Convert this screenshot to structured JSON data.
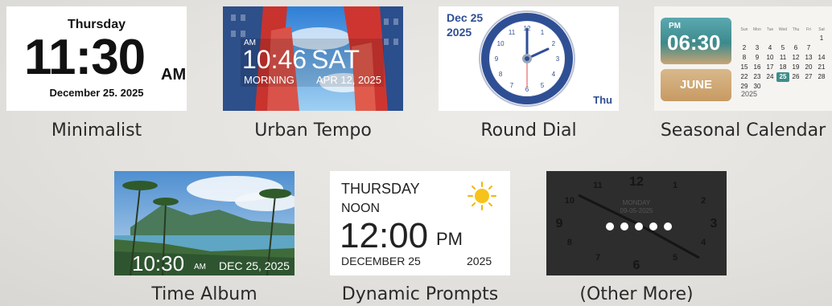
{
  "themes": [
    {
      "label": "Minimalist",
      "day": "Thursday",
      "time": "11:30",
      "ampm": "AM",
      "date": "December 25. 2025"
    },
    {
      "label": "Urban Tempo",
      "ampm": "AM",
      "time": "10:46",
      "day": "SAT",
      "period": "MORNING",
      "date": "APR 12, 2025"
    },
    {
      "label": "Round Dial",
      "date": "Dec 25",
      "year": "2025",
      "day": "Thu"
    },
    {
      "label": "Seasonal Calendar",
      "ampm": "PM",
      "time": "06:30",
      "month": "JUNE",
      "year": "2025",
      "weekdays": [
        "Sun",
        "Mon",
        "Tue",
        "Wed",
        "Thu",
        "Fri",
        "Sat"
      ],
      "weeks": [
        [
          "",
          "",
          "",
          "",
          "",
          "",
          "1"
        ],
        [
          "2",
          "3",
          "4",
          "5",
          "6",
          "7",
          ""
        ],
        [
          "8",
          "9",
          "10",
          "11",
          "12",
          "13",
          "14"
        ],
        [
          "15",
          "16",
          "17",
          "18",
          "19",
          "20",
          "21"
        ],
        [
          "22",
          "23",
          "24",
          "25",
          "26",
          "27",
          "28"
        ],
        [
          "29",
          "30",
          "",
          "",
          "",
          "",
          ""
        ]
      ],
      "highlight": "25"
    },
    {
      "label": "Time Album",
      "time": "10:30",
      "ampm": "AM",
      "date": "DEC 25, 2025"
    },
    {
      "label": "Dynamic Prompts",
      "day": "THURSDAY",
      "period": "NOON",
      "time": "12:00",
      "ampm": "PM",
      "date": "DECEMBER 25",
      "year": "2025"
    },
    {
      "label": "(Other More)",
      "day": "MONDAY",
      "date": "09-05-2025",
      "numerals": [
        "12",
        "1",
        "2",
        "3",
        "4",
        "5",
        "6",
        "7",
        "8",
        "9",
        "10",
        "11"
      ]
    }
  ],
  "colors": {
    "dial_blue": "#2f4f95",
    "seasonal_teal": "#3c8a8c",
    "highlight_teal": "#3d8d8c"
  }
}
